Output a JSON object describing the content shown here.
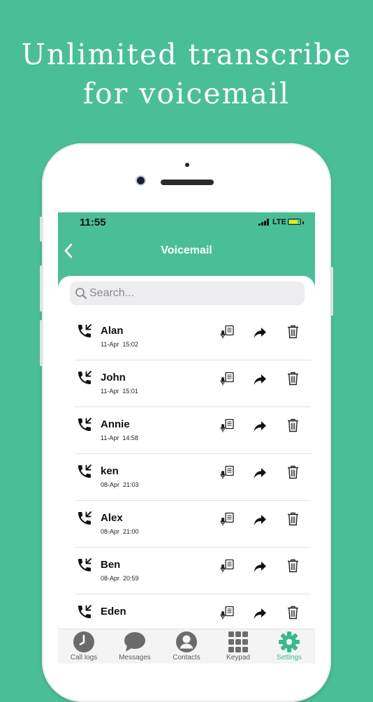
{
  "headline": {
    "line1": "Unlimited transcribe",
    "line2": "for voicemail"
  },
  "status_bar": {
    "time": "11:55",
    "network": "LTE",
    "battery_color": "#F5E400"
  },
  "nav": {
    "back_icon": "chevron-left-icon",
    "title": "Voicemail"
  },
  "search": {
    "placeholder": "Search..."
  },
  "voicemails": [
    {
      "name": "Alan",
      "date": "11-Apr",
      "time": "15:02"
    },
    {
      "name": "John",
      "date": "11-Apr",
      "time": "15:01"
    },
    {
      "name": "Annie",
      "date": "11-Apr",
      "time": "14:58"
    },
    {
      "name": "ken",
      "date": "08-Apr",
      "time": "21:03"
    },
    {
      "name": "Alex",
      "date": "08-Apr",
      "time": "21:00"
    },
    {
      "name": "Ben",
      "date": "08-Apr",
      "time": "20:59"
    },
    {
      "name": "Eden",
      "date": "",
      "time": ""
    }
  ],
  "row_icons": [
    "phone-callback-icon",
    "transcribe-icon",
    "forward-icon",
    "trash-icon"
  ],
  "tabs": [
    {
      "label": "Call logs",
      "icon": "clock-icon",
      "active": false
    },
    {
      "label": "Messages",
      "icon": "chat-bubble-icon",
      "active": false
    },
    {
      "label": "Contacts",
      "icon": "person-icon",
      "active": false
    },
    {
      "label": "Keypad",
      "icon": "keypad-icon",
      "active": false
    },
    {
      "label": "Settings",
      "icon": "gear-icon",
      "active": true
    }
  ],
  "colors": {
    "accent": "#4ABE97",
    "active_tab": "#3AB88F"
  }
}
